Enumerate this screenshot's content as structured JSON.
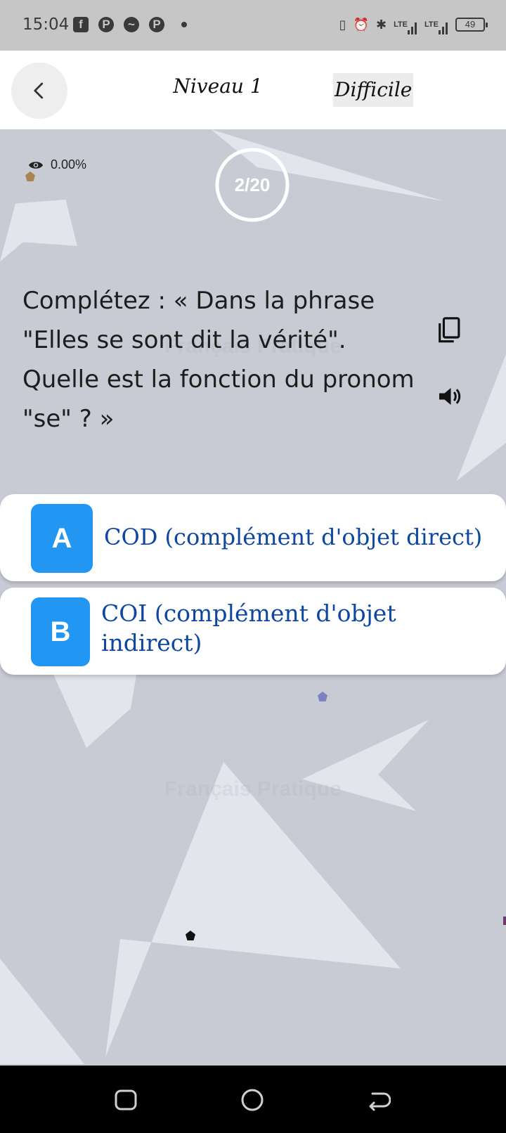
{
  "status_bar": {
    "time": "15:04",
    "apps": [
      "facebook-icon",
      "p-icon",
      "messenger-icon",
      "p-icon"
    ],
    "network": [
      "LTE",
      "LTE"
    ],
    "battery": "49"
  },
  "header": {
    "back_icon": "chevron-left-icon",
    "level": "Niveau 1",
    "difficulty": "Difficile"
  },
  "stats": {
    "views": "0.00%",
    "progress": "2/20",
    "progress_fraction": 0.1
  },
  "question": {
    "text": "Complétez : « Dans la phrase \"Elles se sont dit la vérité\". Quelle est la fonction du pronom \"se\" ? »"
  },
  "watermark": "Français Pratique",
  "answers": [
    {
      "letter": "A",
      "text": "COD (complément d'objet direct)"
    },
    {
      "letter": "B",
      "text": "COI (complément d'objet indirect)"
    }
  ],
  "colors": {
    "accent": "#2196f3",
    "answer_text": "#0d47a1",
    "background": "#c8cbd3"
  }
}
